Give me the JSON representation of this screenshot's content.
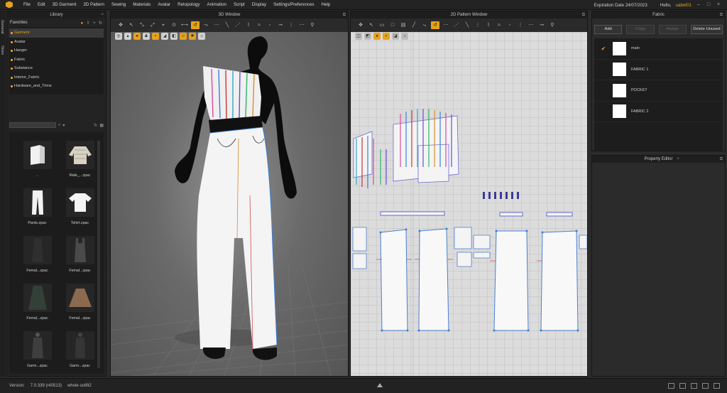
{
  "menubar": {
    "items": [
      "File",
      "Edit",
      "3D Garment",
      "2D Pattern",
      "Sewing",
      "Materials",
      "Avatar",
      "Retopology",
      "Animation",
      "Script",
      "Display",
      "Settings/Preferences",
      "Help"
    ],
    "expiration": "Expiration Date 24/07/2023",
    "hello": "Hello,",
    "user": "uabet01"
  },
  "side_tabs": [
    "General",
    "Store"
  ],
  "library": {
    "title": "Library",
    "favorites_label": "Favorites",
    "favorites": [
      "Garment",
      "Avatar",
      "Hanger",
      "Fabric",
      "Substance",
      "Interior_Fabric",
      "Hardware_and_Trims"
    ],
    "selected_favorite": "Garment",
    "thumbs": [
      "..",
      "Male_...zpac",
      "Pants.zpac",
      "Tshirt.zpac",
      "Femal...zpac",
      "Femal...zpac",
      "Femal...zpac",
      "Femal...zpac",
      "Garm...zpac",
      "Garm...zpac"
    ]
  },
  "window3d": {
    "title": "3D Window"
  },
  "window2d": {
    "title": "2D Pattern Window"
  },
  "fabric": {
    "title": "Fabric",
    "buttons": {
      "add": "Add",
      "copy": "Copy",
      "assign": "Assign",
      "delete_unused": "Delete Unused"
    },
    "items": [
      {
        "name": "main",
        "checked": true,
        "color": "#ffffff"
      },
      {
        "name": "FABRIC 1",
        "checked": false,
        "color": "#ffffff"
      },
      {
        "name": "POCKET",
        "checked": false,
        "color": "#ffffff"
      },
      {
        "name": "FABRIC 2",
        "checked": false,
        "color": "#ffffff"
      }
    ]
  },
  "property_editor": {
    "title": "Property Editor"
  },
  "status": {
    "version_label": "Version:",
    "version": "7.0.339 (r40513)",
    "file": "whole outfit2"
  },
  "colors": {
    "accent": "#e6a21b",
    "panel": "#2b2b2b",
    "viewport2d": "#dcdcdc"
  }
}
